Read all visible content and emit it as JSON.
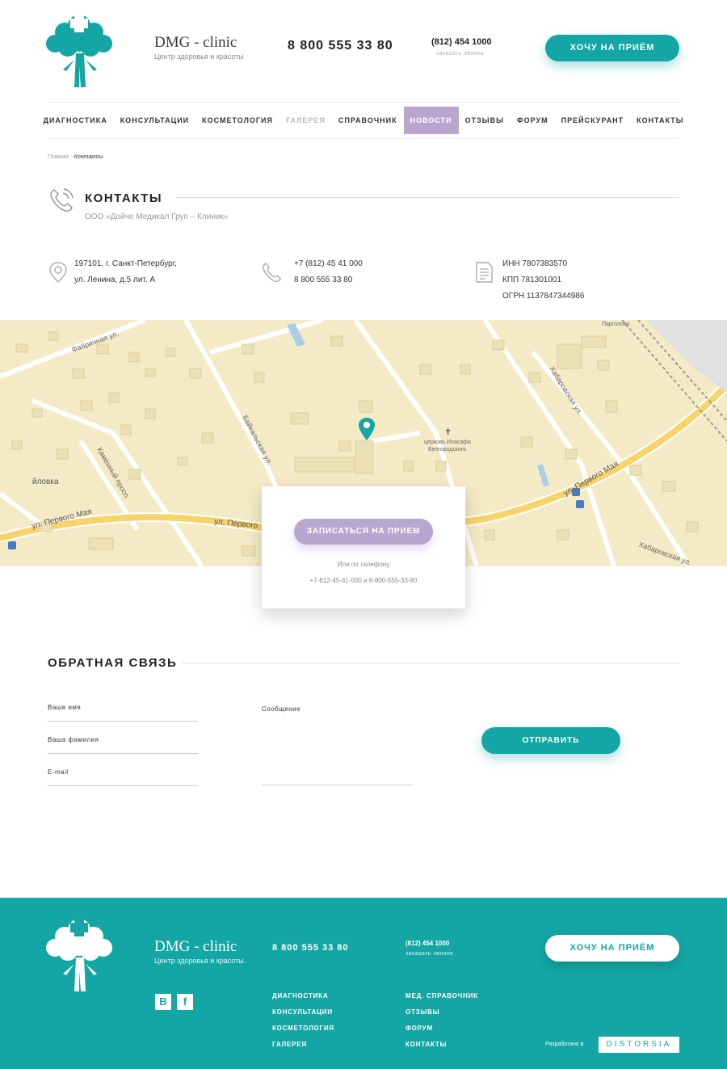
{
  "header": {
    "brand_name": "DMG - clinic",
    "brand_sub": "Центр здоровья и красоты",
    "phone_main": "8 800 555 33 80",
    "phone_city": "(812) 454 1000",
    "callback": "заказать звонок",
    "appt_button": "ХОЧУ НА ПРИЁМ",
    "accent_color": "#13a6a4",
    "secondary_color": "#b9a6cf"
  },
  "nav": {
    "items": [
      {
        "label": "ДИАГНОСТИКА"
      },
      {
        "label": "КОНСУЛЬТАЦИИ"
      },
      {
        "label": "КОСМЕТОЛОГИЯ"
      },
      {
        "label": "ГАЛЕРЕЯ"
      },
      {
        "label": "СПРАВОЧНИК"
      },
      {
        "label": "НОВОСТИ"
      },
      {
        "label": "ОТЗЫВЫ"
      },
      {
        "label": "ФОРУМ"
      },
      {
        "label": "ПРЕЙСКУРАНТ"
      },
      {
        "label": "КОНТАКТЫ"
      }
    ],
    "active": "НОВОСТИ",
    "muted": "ГАЛЕРЕЯ"
  },
  "breadcrumb": {
    "home": "Главная",
    "separator": "-",
    "current": "Контакты"
  },
  "page": {
    "title": "КОНТАКТЫ",
    "subtitle": "ООО «Дойче Медикал Груп – Клиник»"
  },
  "info": {
    "address_line1": "197101,  г. Санкт-Петербург,",
    "address_line2": "ул. Ленина,  д.5 лит. А",
    "phone1": "+7 (812) 45 41 000",
    "phone2": "8 800 555 33 80",
    "inn": "ИНН 7807383570",
    "kpp": "КПП 781301001",
    "ogrn": "ОГРН 1137847344986"
  },
  "map": {
    "labels": {
      "street_pervogo_maya": "ул. Первого Мая",
      "street_pervogo": "ул. Первого",
      "street_baikalskaya": "Байкальская ул.",
      "street_khabarovskaya": "Хабаровская ул.",
      "street_fabrichnaya": "Фабричная ул.",
      "street_kamennyi": "Каменный просп.",
      "church": "церковь Иоасафа",
      "church2": "Белгородского",
      "pargolovo": "Парголово",
      "ayovka": "йловка"
    }
  },
  "map_card": {
    "button": "ЗАПИСАТЬСЯ НА ПРИЕМ",
    "or_text": "Или по телефону",
    "phones": "+7-812-45-41-000 и 8-800-555-33-80"
  },
  "feedback": {
    "title": "ОБРАТНАЯ СВЯЗЬ",
    "first_name": "Ваше имя",
    "last_name": "Ваша фамилия",
    "email": "E-mail",
    "message": "Сообщение",
    "send": "ОТПРАВИТЬ"
  },
  "footer": {
    "brand_name": "DMG - clinic",
    "brand_sub": "Центр здоровья и красоты",
    "phone_main": "8 800 555 33 80",
    "phone_city": "(812) 454 1000",
    "callback": "заказать звонок",
    "appt_button": "ХОЧУ НА ПРИЁМ",
    "social_vk": "B",
    "social_fb": "f",
    "nav_col1": [
      "ДИАГНОСТИКА",
      "КОНСУЛЬТАЦИИ",
      "КОСМЕТОЛОГИЯ",
      "ГАЛЕРЕЯ"
    ],
    "nav_col2": [
      "МЕД. СПРАВОЧНИК",
      "ОТЗЫВЫ",
      "ФОРУМ",
      "КОНТАКТЫ"
    ],
    "developed_by": "Разработано в",
    "developer": "DISTORSIA"
  }
}
